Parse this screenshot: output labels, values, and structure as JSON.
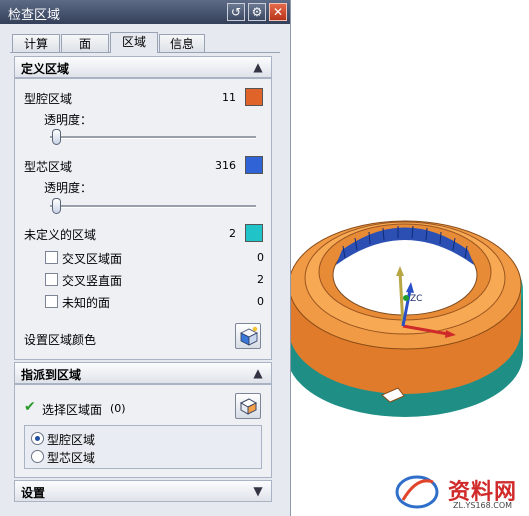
{
  "dialog": {
    "title": "检查区域",
    "tabs": [
      {
        "label": "计算"
      },
      {
        "label": "面"
      },
      {
        "label": "区域"
      },
      {
        "label": "信息"
      }
    ],
    "active_tab": "区域"
  },
  "define_regions": {
    "header": "定义区域",
    "cavity": {
      "label": "型腔区域",
      "count": "11",
      "color": "#e0642a"
    },
    "cavity_transparency": {
      "label": "透明度：",
      "value": 0
    },
    "core": {
      "label": "型芯区域",
      "count": "316",
      "color": "#2f63d6"
    },
    "core_transparency": {
      "label": "透明度：",
      "value": 0
    },
    "undefined": {
      "label": "未定义的区域",
      "count": "2",
      "color": "#1fc3c8"
    },
    "sub_items": [
      {
        "label": "交叉区域面",
        "count": "0",
        "checked": false
      },
      {
        "label": "交叉竖直面",
        "count": "2",
        "checked": false
      },
      {
        "label": "未知的面",
        "count": "0",
        "checked": false
      }
    ],
    "set_color_label": "设置区域颜色"
  },
  "assign": {
    "header": "指派到区域",
    "select_label": "选择区域面",
    "select_count": "(0)",
    "options": [
      {
        "label": "型腔区域",
        "selected": true
      },
      {
        "label": "型芯区域",
        "selected": false
      }
    ]
  },
  "settings": {
    "header": "设置"
  },
  "watermark": {
    "text": "资料网",
    "sub": "ZL.YS168.COM"
  }
}
